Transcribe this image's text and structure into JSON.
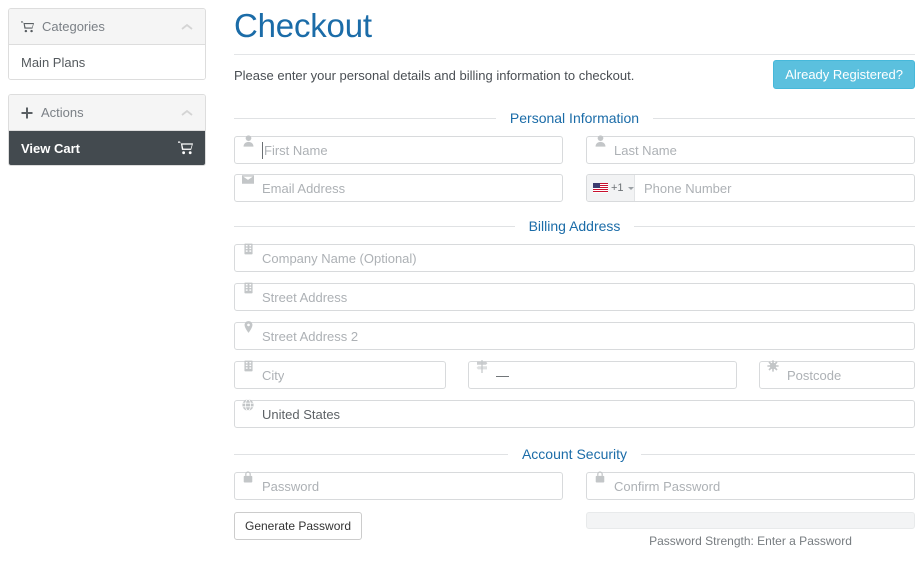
{
  "sidebar": {
    "panels": [
      {
        "title": "Categories",
        "icon": "cart-icon",
        "collapse_icon": "chevron-up-icon",
        "items": [
          {
            "label": "Main Plans",
            "active": false,
            "icon": null
          }
        ]
      },
      {
        "title": "Actions",
        "icon": "plus-icon",
        "collapse_icon": "chevron-up-icon",
        "items": [
          {
            "label": "View Cart",
            "active": true,
            "icon": "cart-icon"
          }
        ]
      }
    ]
  },
  "main": {
    "title": "Checkout",
    "intro": "Please enter your personal details and billing information to checkout.",
    "already_registered_label": "Already Registered?",
    "sections": {
      "personal": {
        "legend": "Personal Information",
        "first_name": {
          "placeholder": "First Name",
          "value": "",
          "icon": "user-icon",
          "focused": true
        },
        "last_name": {
          "placeholder": "Last Name",
          "value": "",
          "icon": "user-icon"
        },
        "email": {
          "placeholder": "Email Address",
          "value": "",
          "icon": "envelope-icon"
        },
        "phone": {
          "placeholder": "Phone Number",
          "value": "",
          "country_flag": "us-flag-icon",
          "dial_code": "+1"
        }
      },
      "billing": {
        "legend": "Billing Address",
        "company": {
          "placeholder": "Company Name (Optional)",
          "value": "",
          "icon": "building-icon"
        },
        "street1": {
          "placeholder": "Street Address",
          "value": "",
          "icon": "building-icon"
        },
        "street2": {
          "placeholder": "Street Address 2",
          "value": "",
          "icon": "map-pin-icon"
        },
        "city": {
          "placeholder": "City",
          "value": "",
          "icon": "building-icon"
        },
        "state": {
          "placeholder": "",
          "value": "—",
          "icon": "signpost-icon"
        },
        "postcode": {
          "placeholder": "Postcode",
          "value": "",
          "icon": "asterisk-icon"
        },
        "country": {
          "placeholder": "",
          "value": "United States",
          "icon": "globe-icon"
        }
      },
      "security": {
        "legend": "Account Security",
        "password": {
          "placeholder": "Password",
          "value": "",
          "icon": "lock-icon"
        },
        "confirm_password": {
          "placeholder": "Confirm Password",
          "value": "",
          "icon": "lock-icon"
        },
        "generate_password_label": "Generate Password",
        "strength_caption": "Password Strength: Enter a Password",
        "strength_percent": 0
      }
    }
  },
  "colors": {
    "title_blue": "#1b6ca8",
    "legend_blue": "#1b6ca8",
    "info_button": "#5bc0de",
    "sidebar_active": "#434a4f",
    "panel_header": "#f5f5f5",
    "border": "#dddddd"
  }
}
